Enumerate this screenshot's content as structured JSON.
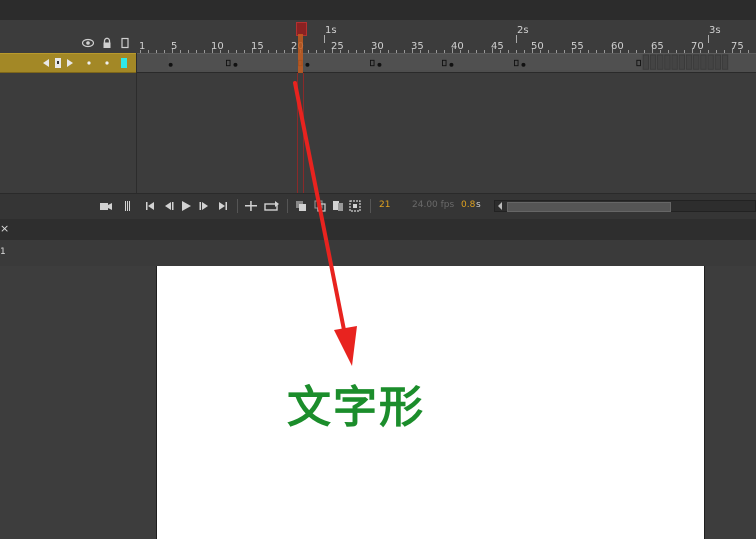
{
  "timeline": {
    "seconds_labels": [
      "1s",
      "2s",
      "3s"
    ],
    "frame_labels": [
      "1",
      "5",
      "10",
      "15",
      "20",
      "25",
      "30",
      "35",
      "40",
      "45",
      "50",
      "55",
      "60",
      "65",
      "70",
      "75"
    ],
    "layer_header_icons": [
      "eye-icon",
      "lock-icon",
      "outline-icon"
    ],
    "current_frame": "21",
    "fps": "24.00 fps",
    "seconds": "0.8",
    "seconds_unit": "s"
  },
  "document": {
    "close_glyph": "×",
    "scene_number": "1"
  },
  "stage": {
    "text": "文字形",
    "text_color": "#1b8d2b"
  },
  "colors": {
    "layer_selected": "#a38826",
    "playhead": "#e0701f",
    "annotation_arrow": "#e8231f"
  }
}
